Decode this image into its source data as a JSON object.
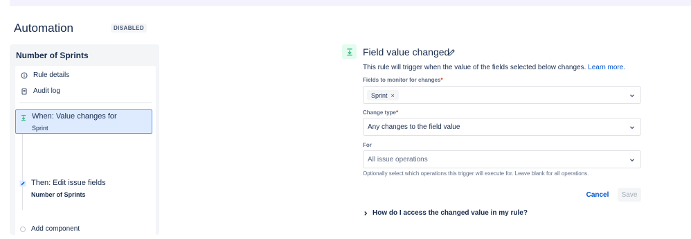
{
  "header": {
    "app_title": "Automation",
    "status_badge": "DISABLED"
  },
  "sidebar": {
    "rule_name": "Number of Sprints",
    "nav": [
      {
        "label": "Rule details",
        "icon": "info-icon"
      },
      {
        "label": "Audit log",
        "icon": "document-icon"
      }
    ],
    "steps": [
      {
        "title": "When: Value changes for",
        "subtitle": "Sprint",
        "icon": "trigger-icon",
        "selected": true
      },
      {
        "title": "Then: Edit issue fields",
        "subtitle": "Number of Sprints",
        "icon": "pencil-icon",
        "selected": false
      }
    ],
    "add_component": "Add component"
  },
  "panel": {
    "title": "Field value changed",
    "description": "This rule will trigger when the value of the fields selected below changes.",
    "learn_more": "Learn more.",
    "fields_label": "Fields to monitor for changes",
    "required_mark": "*",
    "fields_chips": [
      "Sprint"
    ],
    "chip_remove": "×",
    "change_type_label": "Change type",
    "change_type_value": "Any changes to the field value",
    "for_label": "For",
    "for_placeholder": "All issue operations",
    "for_helper": "Optionally select which operations this trigger will execute for. Leave blank for all operations.",
    "cancel_label": "Cancel",
    "save_label": "Save",
    "faq_label": "How do I access the changed value in my rule?"
  },
  "colors": {
    "accent": "#0052cc",
    "selection": "#deebff",
    "selection_border": "#4c9aff",
    "trigger_green": "#36b37e",
    "action_blue": "#0065ff",
    "required": "#de350b"
  }
}
